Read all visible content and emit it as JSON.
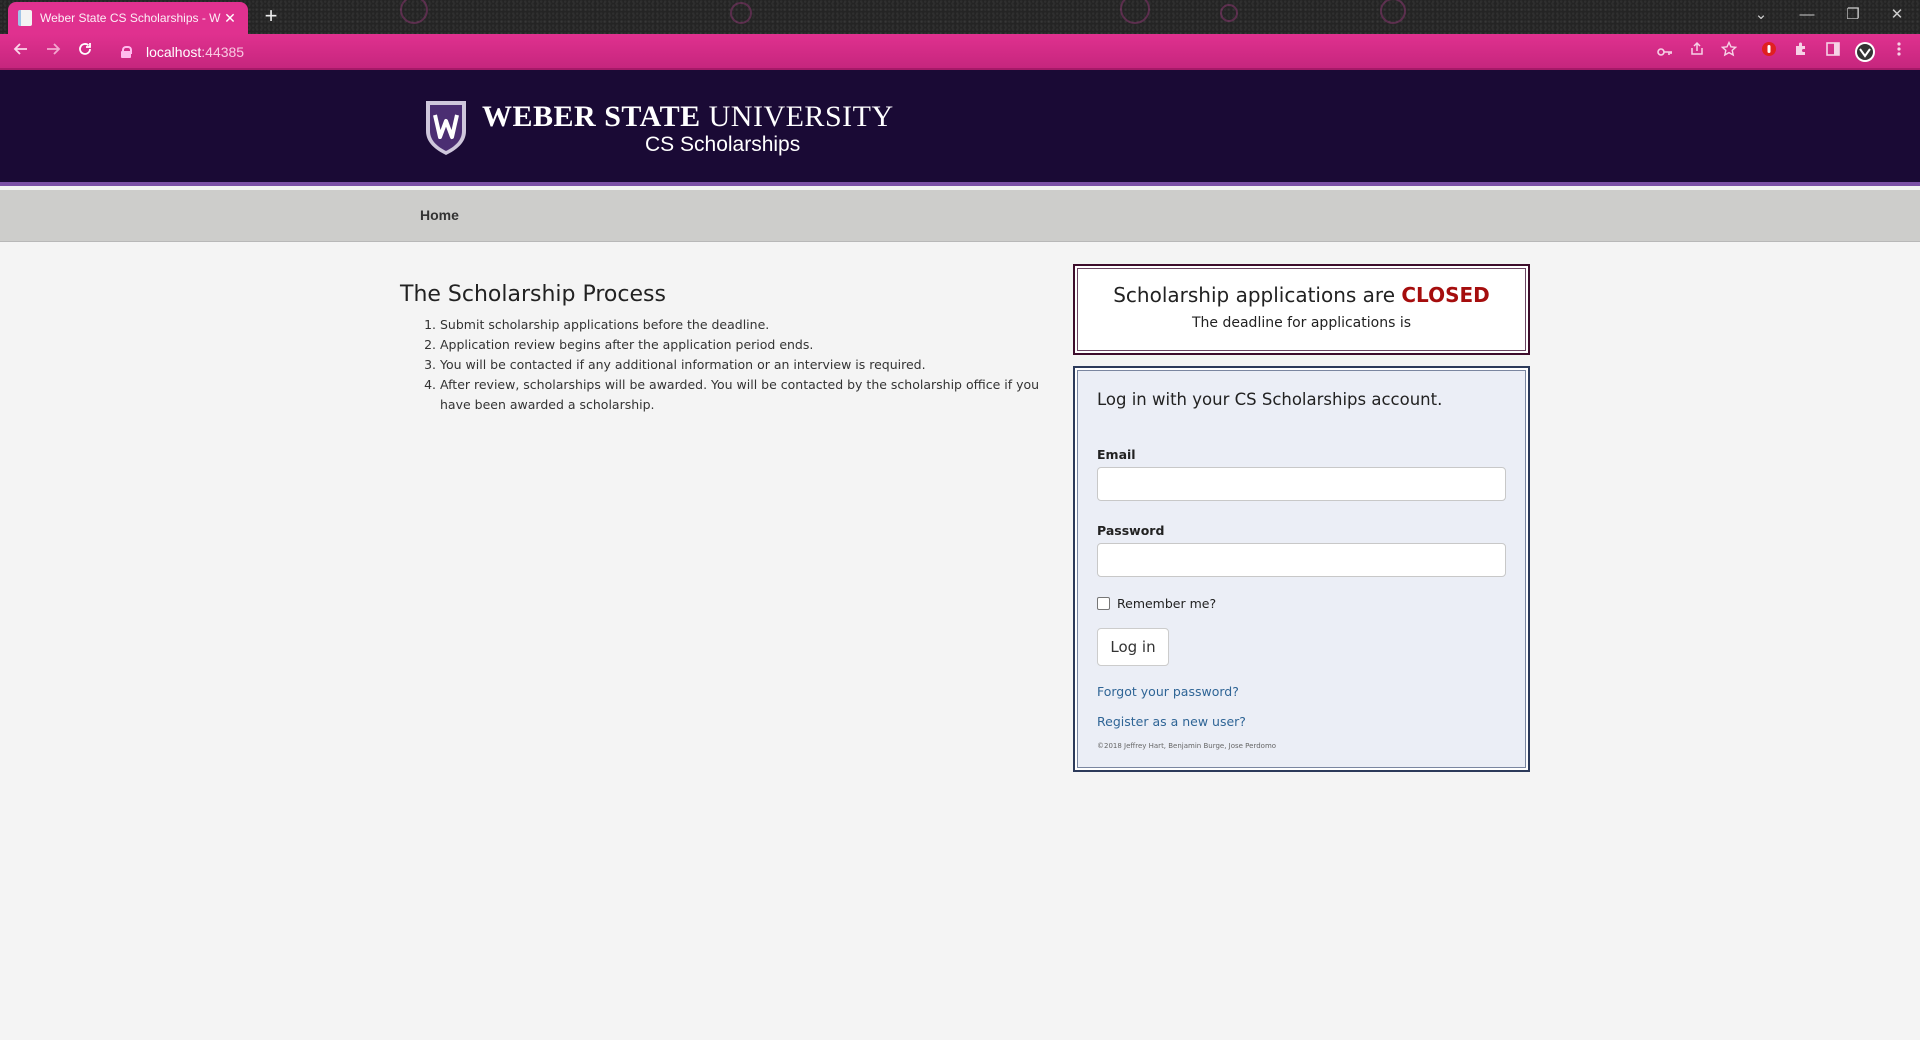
{
  "browser": {
    "tab_title": "Weber State CS Scholarships - W",
    "tab_close": "✕",
    "new_tab": "+",
    "url_host": "localhost",
    "url_port": ":44385",
    "icons": [
      "back-icon",
      "forward-icon",
      "reload-icon",
      "key-icon",
      "share-icon",
      "star-icon",
      "extension-icon",
      "puzzle-icon",
      "sidepanel-icon",
      "profile-icon",
      "menu-icon"
    ],
    "window_controls": {
      "list": "⌄",
      "minimize": "—",
      "restore": "❐",
      "close": "✕"
    }
  },
  "header": {
    "university_bold": "WEBER STATE",
    "university_light": " UNIVERSITY",
    "subtitle": "CS Scholarships"
  },
  "nav": {
    "home": "Home"
  },
  "process": {
    "title": "The Scholarship Process",
    "steps": [
      "Submit scholarship applications before the deadline.",
      "Application review begins after the application period ends.",
      "You will be contacted if any additional information or an interview is required.",
      "After review, scholarships will be awarded. You will be contacted by the scholarship office if you have been awarded a scholarship."
    ]
  },
  "status": {
    "prefix": "Scholarship applications are ",
    "state": "CLOSED",
    "deadline": "The deadline for applications is"
  },
  "login": {
    "heading": "Log in with your CS Scholarships account.",
    "email_label": "Email",
    "email_value": "",
    "password_label": "Password",
    "password_value": "",
    "remember_label": "Remember me?",
    "remember_checked": false,
    "submit_label": "Log in",
    "forgot_link": "Forgot your password?",
    "register_link": "Register as a new user?",
    "copyright": "©2018 Jeffrey Hart, Benjamin Burge, Jose Perdomo"
  },
  "colors": {
    "browser_accent": "#e0318f",
    "header_bg": "#1a0a35",
    "header_stripe": "#7c51a7",
    "nav_bg": "#cdcdcb",
    "closed_red": "#a50d0d",
    "link_blue": "#2f6596"
  }
}
